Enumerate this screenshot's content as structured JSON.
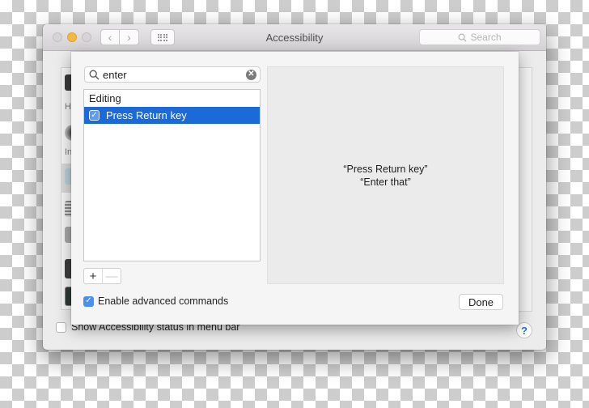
{
  "window": {
    "title": "Accessibility",
    "search_placeholder": "Search",
    "search_icon": "magnifier-icon",
    "nav": {
      "back_icon": "chevron-left-icon",
      "forward_icon": "chevron-right-icon",
      "show_all_icon": "grid-icon"
    },
    "traffic_lights": {
      "close_color": "#d6d4d6",
      "minimize_color": "#f6b83c",
      "zoom_color": "#d6d4d6"
    }
  },
  "sidebar": {
    "partial_labels": [
      "H",
      "In"
    ]
  },
  "footer": {
    "show_status_label": "Show Accessibility status in menu bar",
    "show_status_checked": false,
    "help_label": "?"
  },
  "sheet": {
    "filter": {
      "value": "enter",
      "clear_icon": "clear-icon"
    },
    "list": {
      "group": "Editing",
      "items": [
        {
          "label": "Press Return key",
          "checked": true,
          "selected": true
        }
      ]
    },
    "add_label": "+",
    "remove_label": "—",
    "preview": {
      "line1": "“Press Return key”",
      "line2": "“Enter that”"
    },
    "advanced": {
      "label": "Enable advanced commands",
      "checked": true
    },
    "done_label": "Done",
    "accent_color": "#1b6ad8"
  }
}
